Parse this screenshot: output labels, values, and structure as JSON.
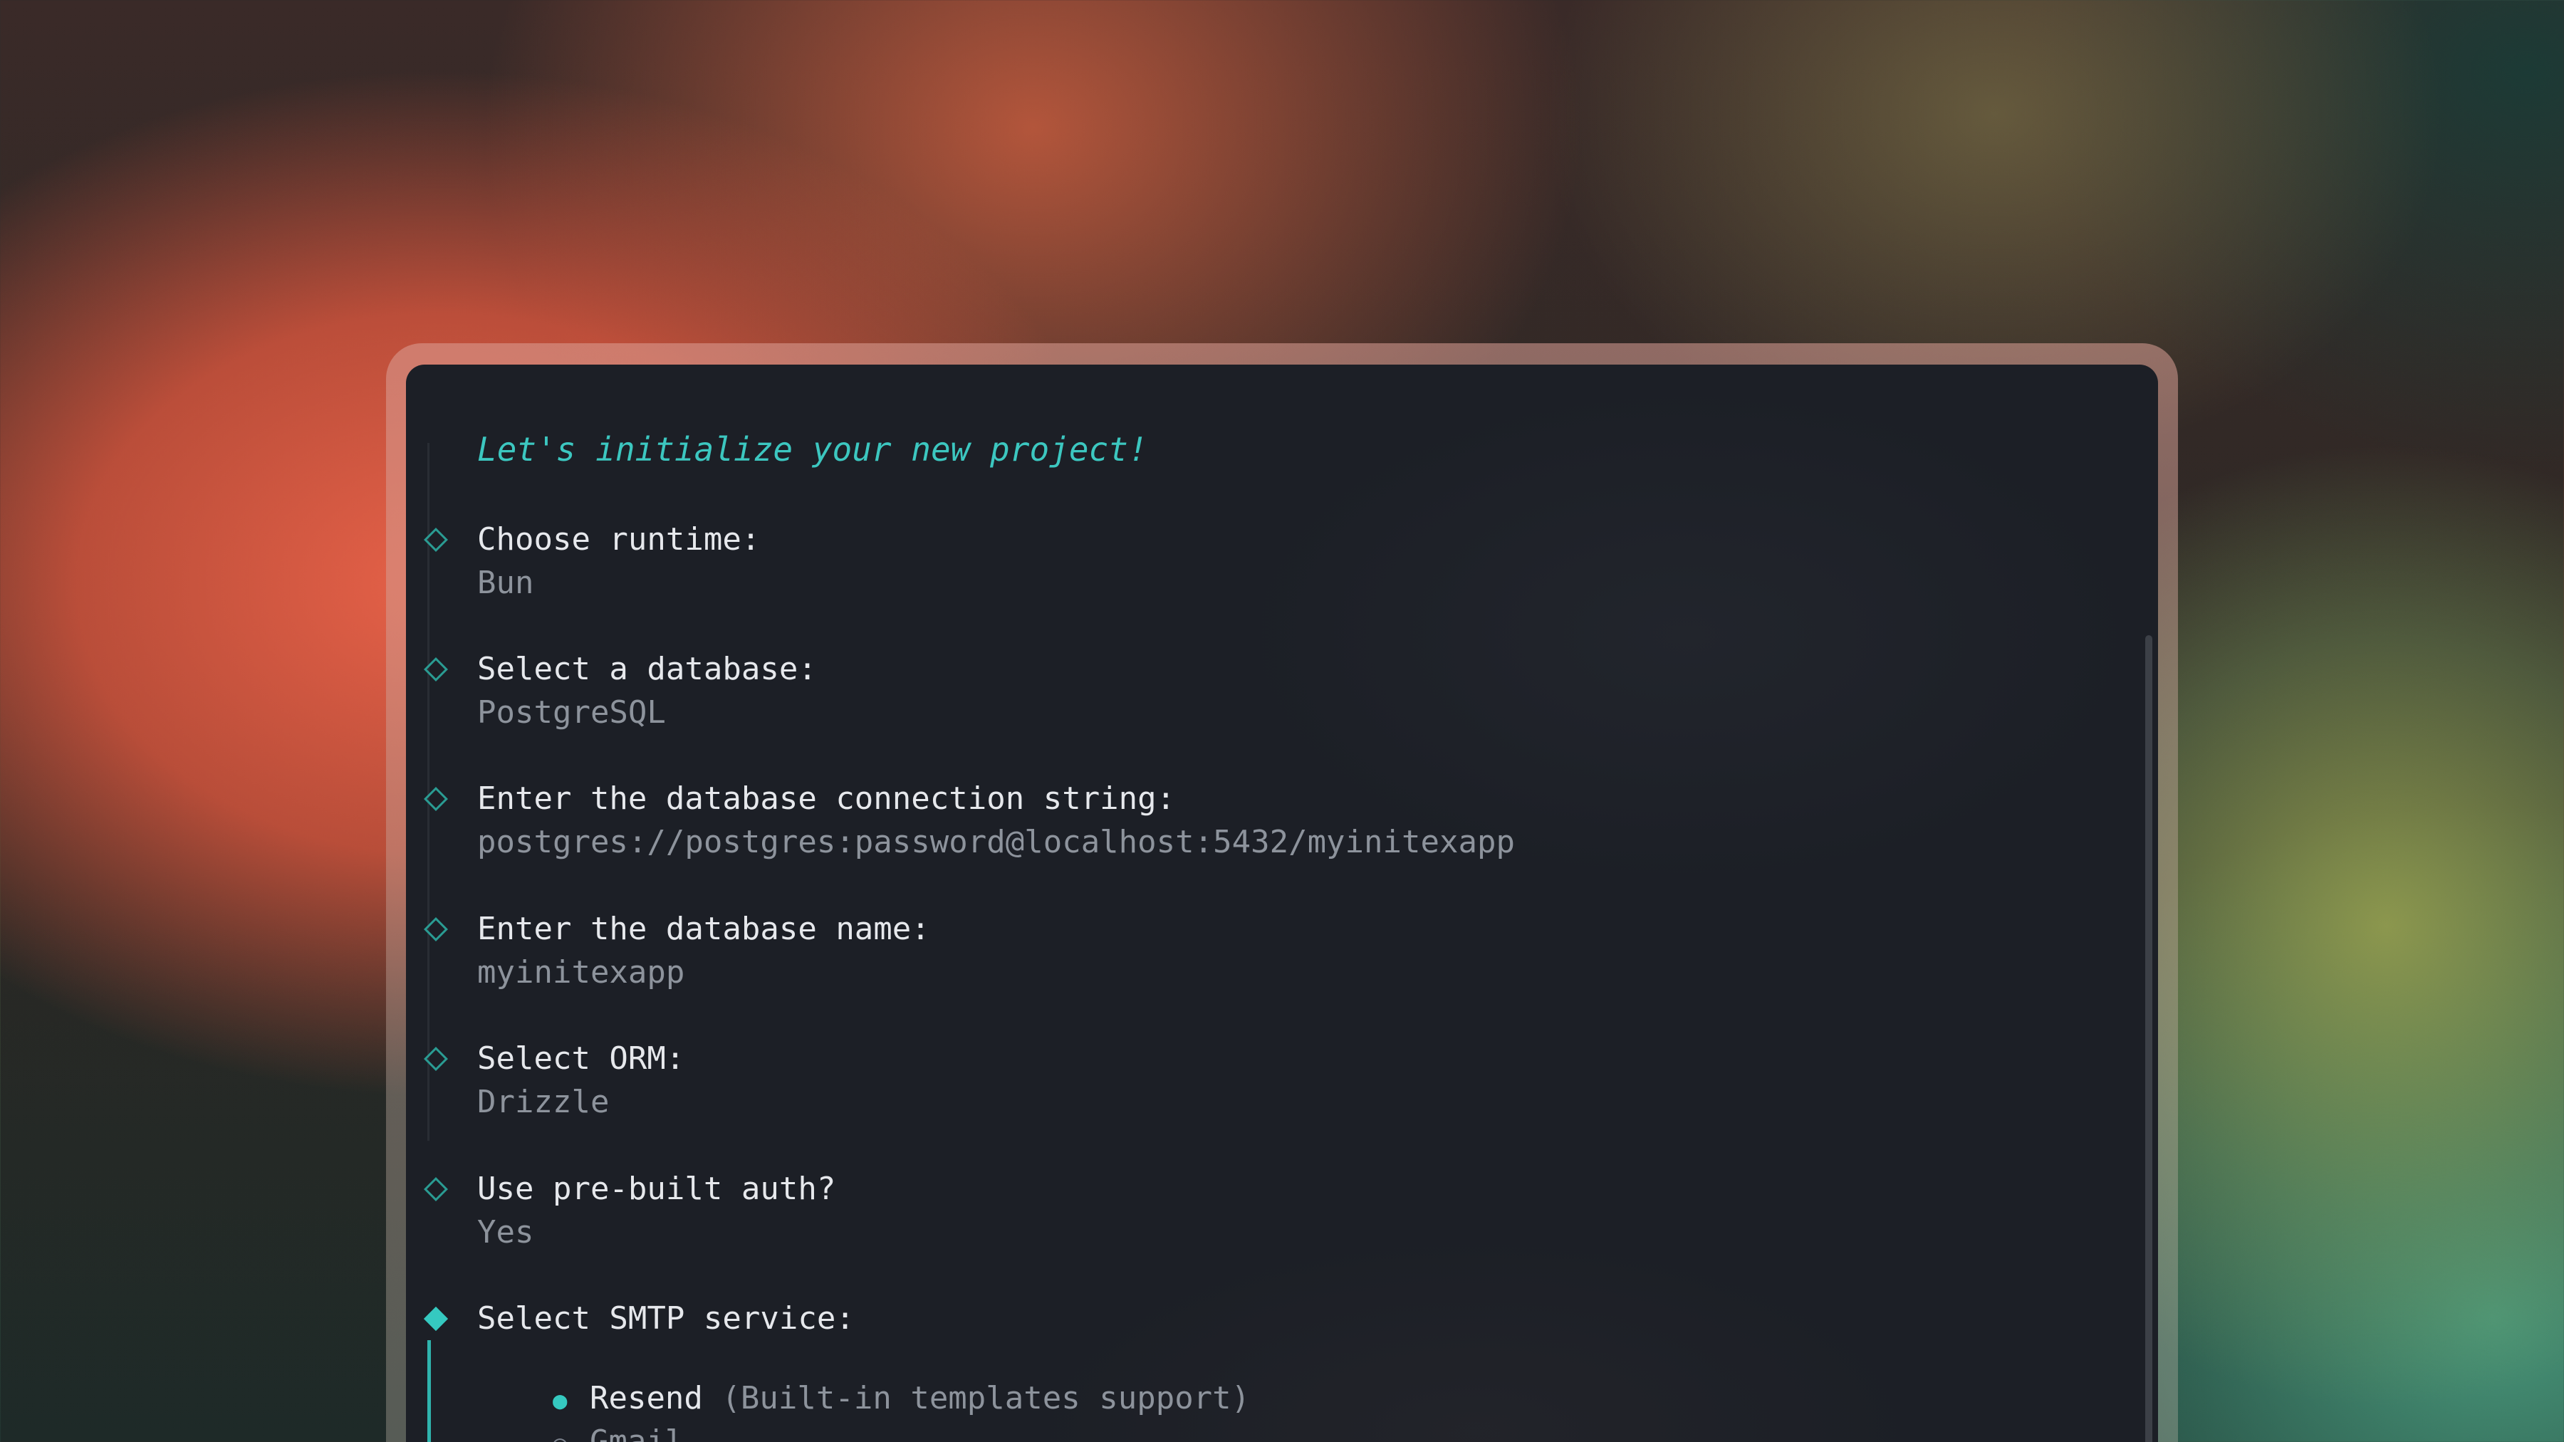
{
  "terminal": {
    "intro": "Let's initialize your new project!",
    "steps": [
      {
        "question": "Choose runtime:",
        "answer": "Bun"
      },
      {
        "question": "Select a database:",
        "answer": "PostgreSQL"
      },
      {
        "question": "Enter the database connection string:",
        "answer": "postgres://postgres:password@localhost:5432/myinitexapp"
      },
      {
        "question": "Enter the database name:",
        "answer": "myinitexapp"
      },
      {
        "question": "Select ORM:",
        "answer": "Drizzle"
      },
      {
        "question": "Use pre-built auth?",
        "answer": "Yes"
      }
    ],
    "active_step": {
      "question": "Select SMTP service:",
      "options": [
        {
          "label": "Resend",
          "hint": "(Built-in templates support)",
          "selected": true,
          "bullet": "●"
        },
        {
          "label": "Gmail",
          "hint": "",
          "selected": false,
          "bullet": "○"
        }
      ]
    }
  },
  "colors": {
    "accent": "#35c9c0",
    "terminal_bg": "#1c1f26",
    "question_text": "#e6e8ec",
    "answer_text": "#8d939c"
  }
}
